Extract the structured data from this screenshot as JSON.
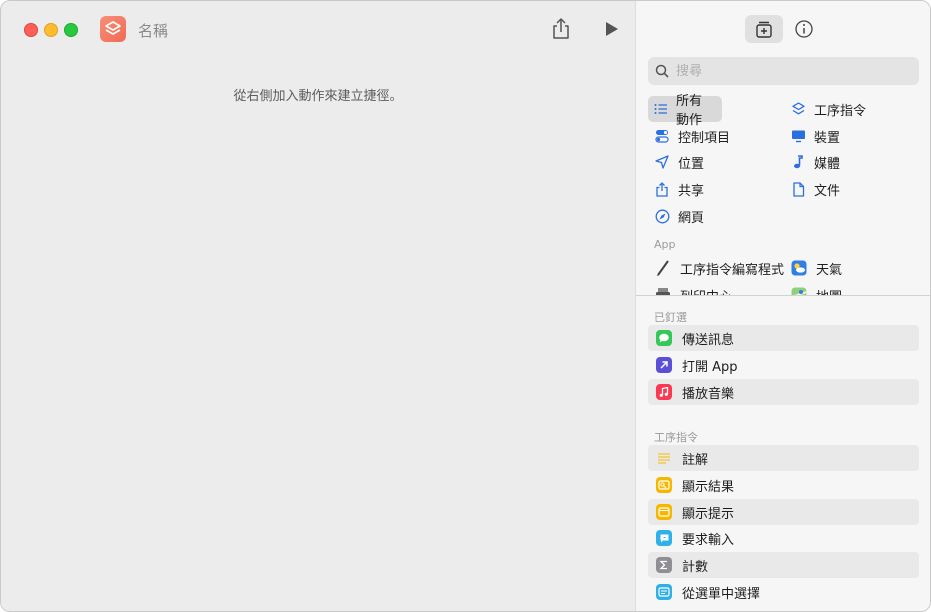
{
  "window": {
    "title": "名稱",
    "hint": "從右側加入動作來建立捷徑。"
  },
  "sidebar": {
    "search": {
      "placeholder": "搜尋",
      "value": ""
    },
    "categories": [
      {
        "label": "所有動作",
        "icon": "list-icon",
        "selected": true
      },
      {
        "label": "工序指令",
        "icon": "shortcuts-icon"
      },
      {
        "label": "控制項目",
        "icon": "toggle-icon"
      },
      {
        "label": "裝置",
        "icon": "display-icon"
      },
      {
        "label": "位置",
        "icon": "location-icon"
      },
      {
        "label": "媒體",
        "icon": "music-note-icon"
      },
      {
        "label": "共享",
        "icon": "share-icon"
      },
      {
        "label": "文件",
        "icon": "document-icon"
      },
      {
        "label": "網頁",
        "icon": "compass-icon"
      }
    ],
    "apps_label": "App",
    "apps": [
      {
        "label": "工序指令編寫程式",
        "icon": "script-editor-icon"
      },
      {
        "label": "天氣",
        "icon": "weather-icon"
      },
      {
        "label": "列印中心",
        "icon": "print-center-icon"
      },
      {
        "label": "地圖",
        "icon": "maps-icon"
      }
    ],
    "pinned_label": "已釘選",
    "pinned": [
      {
        "label": "傳送訊息",
        "icon": "messages-icon",
        "color": "#34c759"
      },
      {
        "label": "打開 App",
        "icon": "open-app-icon",
        "color": "#5a4fd6"
      },
      {
        "label": "播放音樂",
        "icon": "music-icon",
        "color": "#fa3a53"
      }
    ],
    "scripting_label": "工序指令",
    "scripting": [
      {
        "label": "註解",
        "icon": "comment-icon",
        "color": "#f7c948"
      },
      {
        "label": "顯示結果",
        "icon": "show-result-icon",
        "color": "#f5b700"
      },
      {
        "label": "顯示提示",
        "icon": "show-alert-icon",
        "color": "#f5b700"
      },
      {
        "label": "要求輸入",
        "icon": "ask-input-icon",
        "color": "#2fb0e6"
      },
      {
        "label": "計數",
        "icon": "count-icon",
        "color": "#8e8e93"
      },
      {
        "label": "從選單中選擇",
        "icon": "choose-menu-icon",
        "color": "#2fb0e6"
      }
    ]
  }
}
